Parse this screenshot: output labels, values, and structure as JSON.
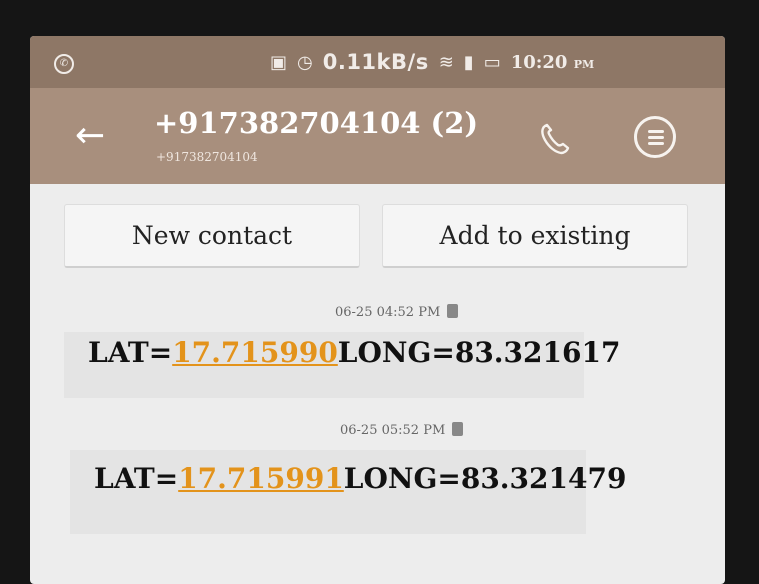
{
  "status_bar": {
    "speed": "0.11kB/s",
    "time": "10:20",
    "ampm": "PM"
  },
  "header": {
    "title": "+917382704104 (2)",
    "subtitle": "+917382704104"
  },
  "actions": {
    "new_contact": "New contact",
    "add_existing": "Add to existing"
  },
  "messages": [
    {
      "timestamp": "06-25 04:52 PM",
      "lat_label": "LAT=",
      "lat_value": "17.715990",
      "long_text": "LONG=83.321617"
    },
    {
      "timestamp": "06-25 05:52 PM",
      "lat_label": "LAT=",
      "lat_value": "17.715991",
      "long_text": "LONG=83.321479"
    }
  ],
  "colors": {
    "header": "#a88f7d",
    "statusbar": "#8e7766",
    "link": "#e3931b"
  }
}
